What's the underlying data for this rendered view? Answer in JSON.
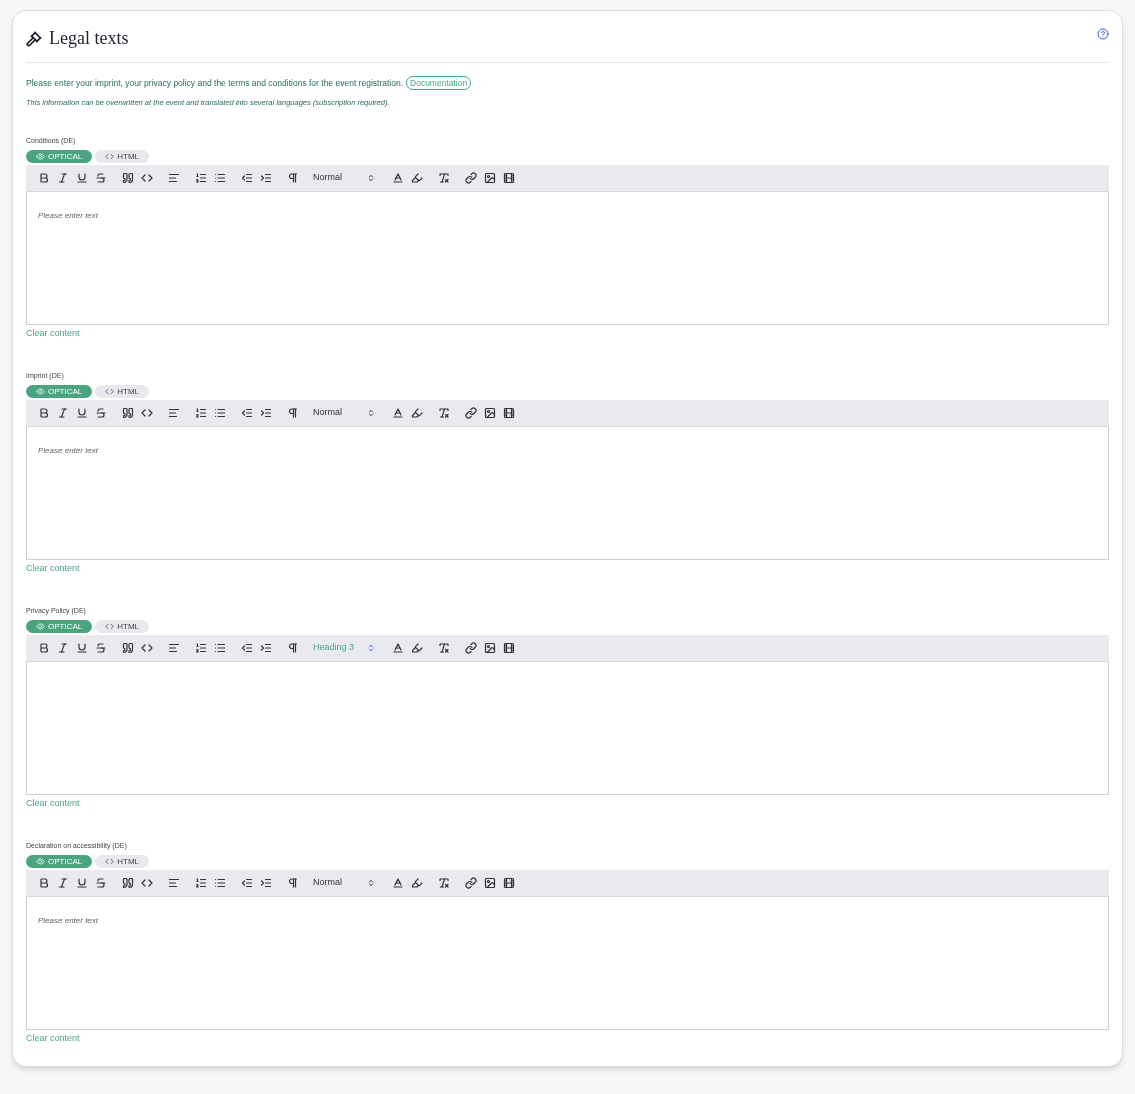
{
  "card": {
    "title": "Legal texts",
    "description": "Please enter your imprint, your privacy policy and the terms and conditions for the event registration.",
    "documentation_link": "Documentation",
    "note": "This information can be overwritten at the event and translated into several languages (subscription required)."
  },
  "editors": [
    {
      "label": "Conditions (DE)",
      "modes": [
        {
          "label": "OPTICAL",
          "selected": true
        },
        {
          "label": "HTML",
          "selected": false
        }
      ],
      "format": "Normal",
      "format_active": false,
      "placeholder": "Please enter text",
      "clear": "Clear content"
    },
    {
      "label": "Imprint (DE)",
      "modes": [
        {
          "label": "OPTICAL",
          "selected": true
        },
        {
          "label": "HTML",
          "selected": false
        }
      ],
      "format": "Normal",
      "format_active": false,
      "placeholder": "Please enter text",
      "clear": "Clear content"
    },
    {
      "label": "Privacy Policy (DE)",
      "modes": [
        {
          "label": "OPTICAL",
          "selected": true
        },
        {
          "label": "HTML",
          "selected": false
        }
      ],
      "format": "Heading 3",
      "format_active": true,
      "clear": "Clear content"
    },
    {
      "label": "Declaration on accessibility (DE)",
      "modes": [
        {
          "label": "OPTICAL",
          "selected": true
        },
        {
          "label": "HTML",
          "selected": false
        }
      ],
      "format": "Normal",
      "format_active": false,
      "placeholder": "Please enter text",
      "clear": "Clear content"
    }
  ]
}
